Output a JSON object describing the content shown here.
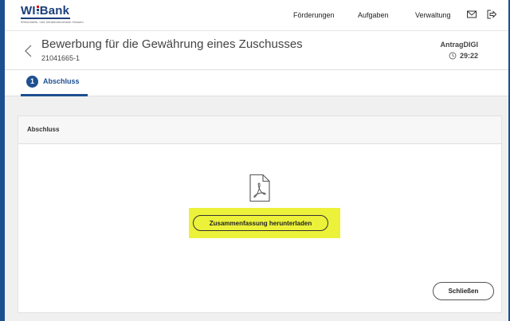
{
  "brand": {
    "logo_text_left": "WI",
    "logo_text_right": "Bank",
    "tagline": "Wirtschafts- und Infrastrukturbank Hessen",
    "colors": {
      "primary": "#1b3f7a",
      "bar_top": "#e30613",
      "bar_mid": "#1b3f7a",
      "bar_bottom": "#7a9cc8"
    }
  },
  "nav": {
    "items": [
      "Förderungen",
      "Aufgaben",
      "Verwaltung"
    ],
    "icons": [
      "mail-icon",
      "logout-icon"
    ]
  },
  "header": {
    "back_icon": "chevron-left-icon",
    "title": "Bewerbung für die Gewährung eines Zuschusses",
    "id": "21041665-1",
    "app_name": "AntragDIGI",
    "timer": "29:22",
    "timer_icon": "clock-icon"
  },
  "steps": [
    {
      "number": "1",
      "label": "Abschluss",
      "active": true
    }
  ],
  "card": {
    "title": "Abschluss",
    "file_icon": "pdf-icon",
    "download_label": "Zusammenfassung herunterladen",
    "close_label": "Schließen",
    "highlight_color": "#ecf13a"
  }
}
